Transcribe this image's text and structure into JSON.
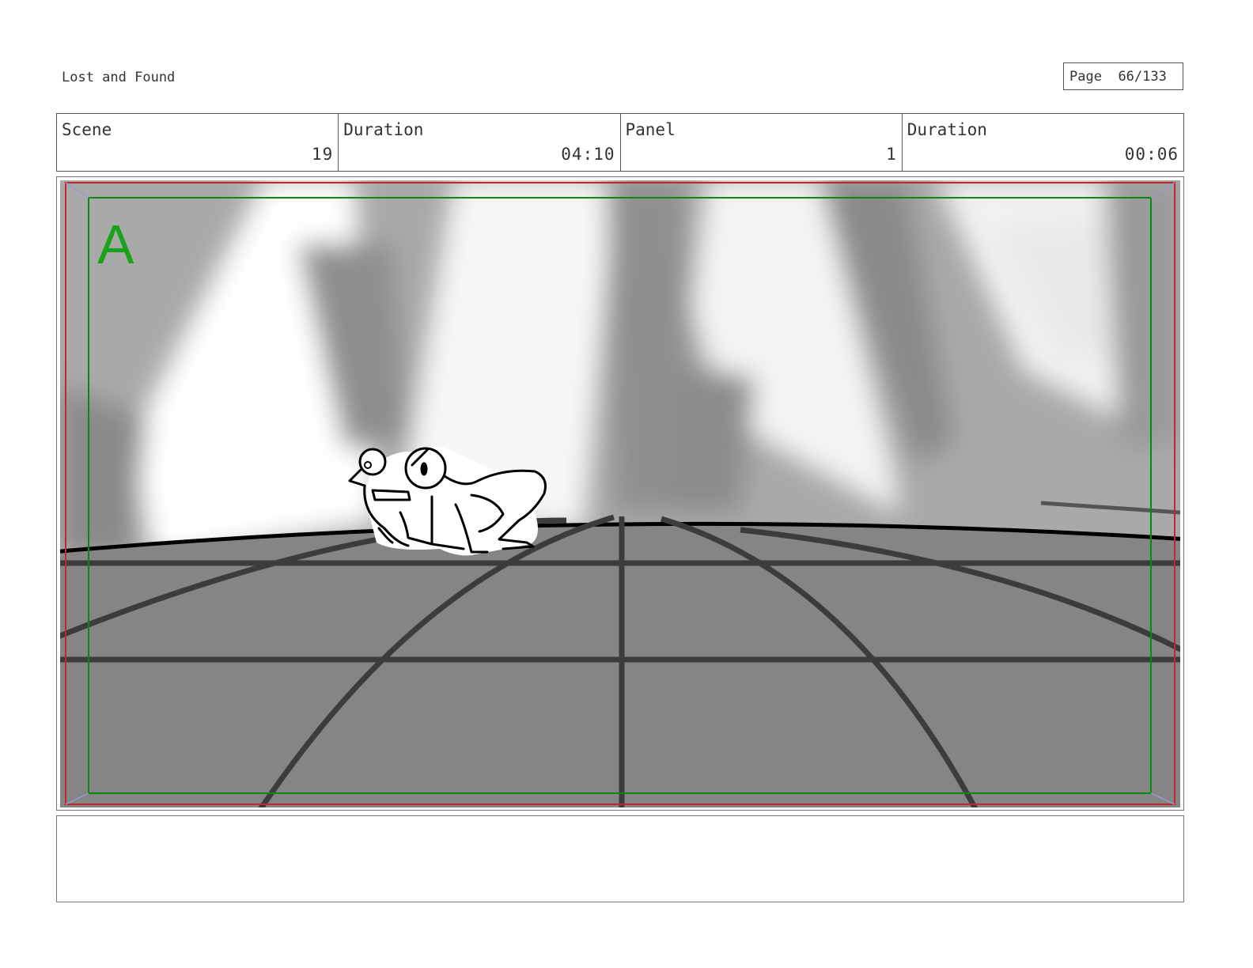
{
  "header": {
    "title": "Lost and Found",
    "page_label": "Page",
    "page_number": "66/133"
  },
  "info": {
    "scene_label": "Scene",
    "scene_value": "19",
    "scene_duration_label": "Duration",
    "scene_duration_value": "04:10",
    "panel_label": "Panel",
    "panel_value": "1",
    "panel_duration_label": "Duration",
    "panel_duration_value": "00:06"
  },
  "panel": {
    "safe_area_marker": "A",
    "colors": {
      "safe_area": "#0a8a0a",
      "marker": "#1aa31a",
      "action_safe": "#c0282b",
      "floor": "#858585",
      "floor_lines": "#3c3c3c"
    }
  },
  "notes": {
    "text": ""
  }
}
